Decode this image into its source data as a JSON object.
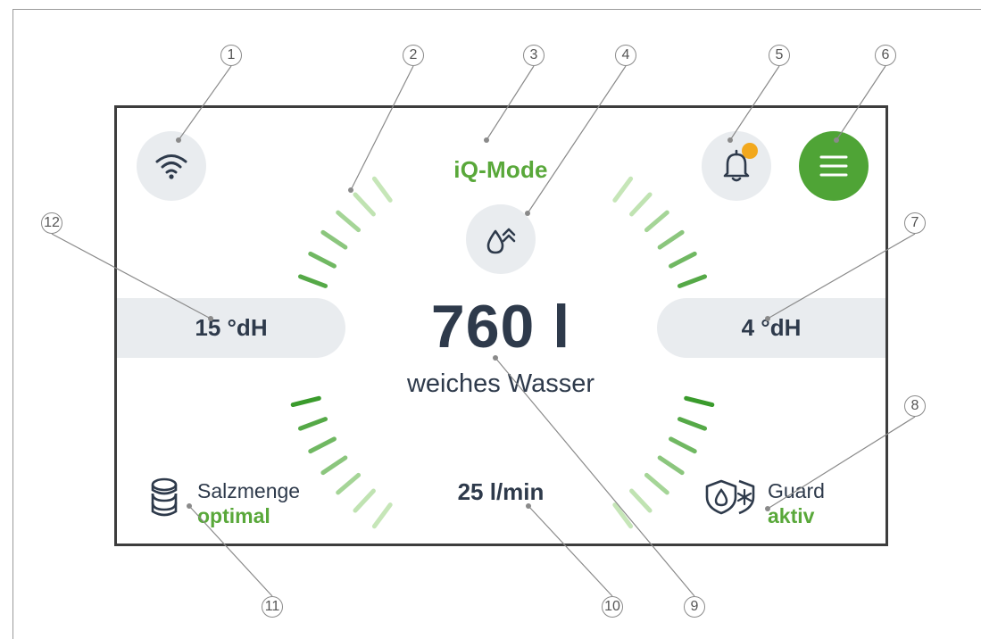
{
  "header": {
    "mode_label": "iQ-Mode"
  },
  "icons": {
    "wifi": "wifi-icon",
    "bell": "bell-icon",
    "menu": "menu-icon",
    "drop": "water-drop-boost-icon",
    "salt": "salt-tablets-icon",
    "guard": "guard-shield-icon"
  },
  "display": {
    "left_hardness": "15 °dH",
    "right_hardness": "4 °dH",
    "volume_value": "760 l",
    "volume_label": "weiches Wasser",
    "flow_rate": "25 l/min"
  },
  "salt": {
    "title": "Salzmenge",
    "status": "optimal"
  },
  "guard": {
    "title": "Guard",
    "status": "aktiv"
  },
  "notification": {
    "has_unread": true
  },
  "callouts": [
    "1",
    "2",
    "3",
    "4",
    "5",
    "6",
    "7",
    "8",
    "9",
    "10",
    "11",
    "12"
  ],
  "colors": {
    "accent_green": "#59a83a",
    "menu_green": "#4fa436",
    "dark_text": "#2e3a4b",
    "button_gray": "#e9ecef",
    "notification_dot": "#f2a81d",
    "gauge_dark": "#3a9b2c",
    "gauge_light": "#c6e6b8"
  }
}
